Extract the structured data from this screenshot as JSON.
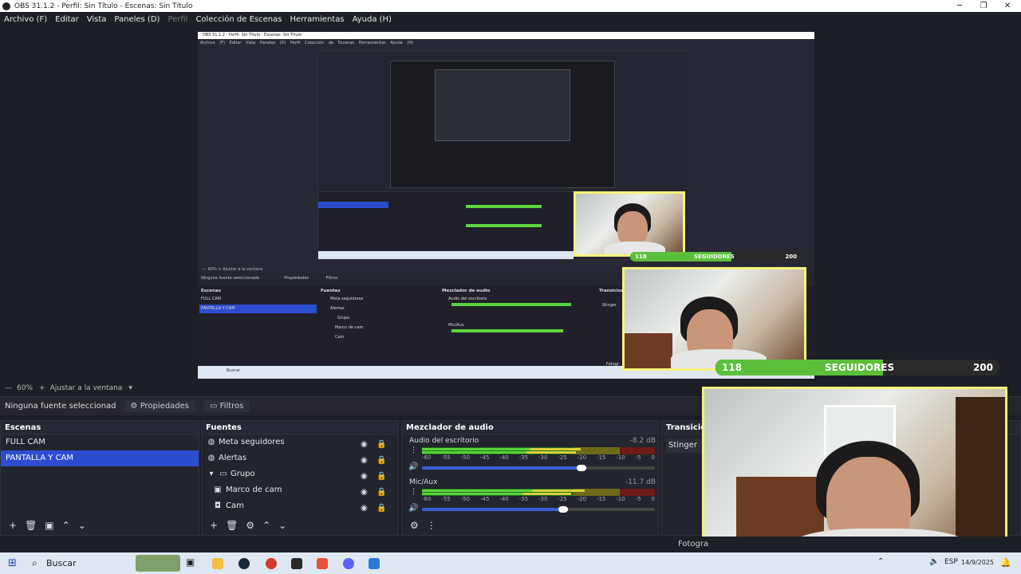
{
  "window": {
    "title": "OBS 31.1.2 - Perfil: Sin Título - Escenas: Sin Título"
  },
  "menu": [
    "Archivo (F)",
    "Editar",
    "Vista",
    "Paneles (D)",
    "Perfil",
    "Colección de Escenas",
    "Herramientas",
    "Ayuda (H)"
  ],
  "preview": {
    "zoom": "60%",
    "fit_label": "Ajustar a la ventana",
    "followers": {
      "current": "118",
      "label": "SEGUIDORES",
      "goal": "200",
      "progress": 0.59
    },
    "nested_menu": "Archivo (F)  Editar  Vista  Paneles (D)  Perfil  Colección de Escenas  Herramientas  Ayuda (H)",
    "nested_title": "OBS 31.1.2 - Perfil: Sin Título - Escenas: Sin Título",
    "nested_none": "Ninguna fuente seleccionada",
    "nested_props": "Propiedades",
    "nested_filters": "Filtros",
    "nested_search": "Buscar",
    "nested_foto": "Fotogr"
  },
  "props_bar": {
    "no_source": "Ninguna fuente seleccionad",
    "properties": "Propiedades",
    "filters": "Filtros"
  },
  "scenes": {
    "title": "Escenas",
    "items": [
      "FULL CAM",
      "PANTALLA Y CAM"
    ],
    "active_index": 1
  },
  "sources": {
    "title": "Fuentes",
    "items": [
      {
        "name": "Meta seguidores",
        "icon": "globe-icon"
      },
      {
        "name": "Alertas",
        "icon": "globe-icon"
      },
      {
        "name": "Grupo",
        "icon": "folder-icon"
      },
      {
        "name": "Marco de cam",
        "icon": "image-icon"
      },
      {
        "name": "Cam",
        "icon": "camera-icon"
      }
    ]
  },
  "mixer": {
    "title": "Mezclador de audio",
    "channels": [
      {
        "name": "Audio del escritorio",
        "db": "-8.2 dB",
        "volume": 0.69
      },
      {
        "name": "Mic/Aux",
        "db": "-11.7 dB",
        "volume": 0.62
      }
    ],
    "scale": [
      "-60",
      "-55",
      "-50",
      "-45",
      "-40",
      "-35",
      "-30",
      "-25",
      "-20",
      "-15",
      "-10",
      "-5",
      "0"
    ]
  },
  "transitions": {
    "title": "Transicion",
    "selected": "Stinger"
  },
  "status": {
    "fotogramas": "Fotogra"
  },
  "taskbar": {
    "search": "Buscar",
    "lang": "ESP",
    "date": "14/9/2025"
  },
  "colors": {
    "accent": "#2d4dd1",
    "follow_bar": "#5cbf3c",
    "cam_border": "#f6f27a"
  }
}
